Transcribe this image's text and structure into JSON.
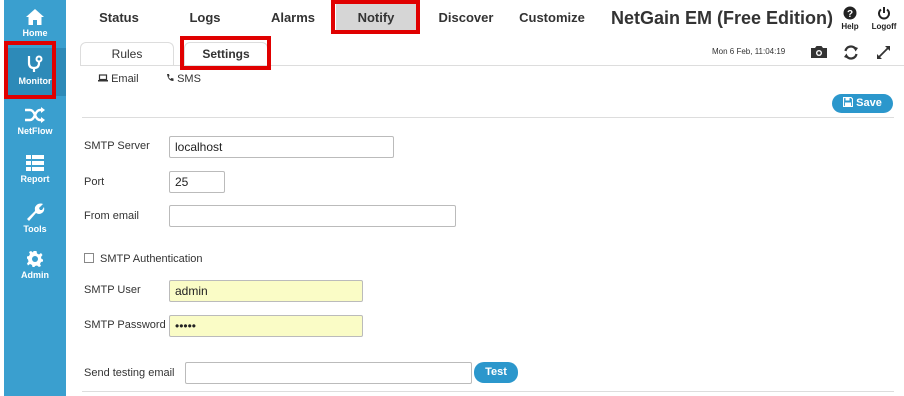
{
  "sidebar": {
    "items": [
      {
        "label": "Home",
        "icon": "home-icon"
      },
      {
        "label": "Monitor",
        "icon": "stethoscope-icon"
      },
      {
        "label": "NetFlow",
        "icon": "shuffle-icon"
      },
      {
        "label": "Report",
        "icon": "list-icon"
      },
      {
        "label": "Tools",
        "icon": "wrench-icon"
      },
      {
        "label": "Admin",
        "icon": "gear-icon"
      }
    ],
    "active": "Monitor"
  },
  "topnav": {
    "tabs": [
      {
        "label": "Status"
      },
      {
        "label": "Logs"
      },
      {
        "label": "Alarms"
      },
      {
        "label": "Notify"
      },
      {
        "label": "Discover"
      },
      {
        "label": "Customize"
      }
    ],
    "active": "Notify",
    "brand": "NetGain EM (Free Edition)",
    "help_label": "Help",
    "logoff_label": "Logoff"
  },
  "subtabs": {
    "items": [
      {
        "label": "Rules"
      },
      {
        "label": "Settings"
      }
    ],
    "active": "Settings",
    "datetime": "Mon 6 Feb, 11:04:19"
  },
  "channels": {
    "email": "Email",
    "sms": "SMS"
  },
  "form": {
    "save_label": "Save",
    "smtp_server_label": "SMTP Server",
    "smtp_server_value": "localhost",
    "port_label": "Port",
    "port_value": "25",
    "from_email_label": "From email",
    "from_email_value": "",
    "smtp_auth_label": "SMTP Authentication",
    "smtp_auth_checked": false,
    "smtp_user_label": "SMTP User",
    "smtp_user_value": "admin",
    "smtp_password_label": "SMTP Password",
    "smtp_password_value": "•••••",
    "send_testing_label": "Send testing email",
    "send_testing_value": "",
    "test_label": "Test"
  },
  "colors": {
    "sidebar": "#3a9fcf",
    "accent": "#2b97cc",
    "highlight": "#e00000",
    "autofill": "#fafcc6"
  }
}
